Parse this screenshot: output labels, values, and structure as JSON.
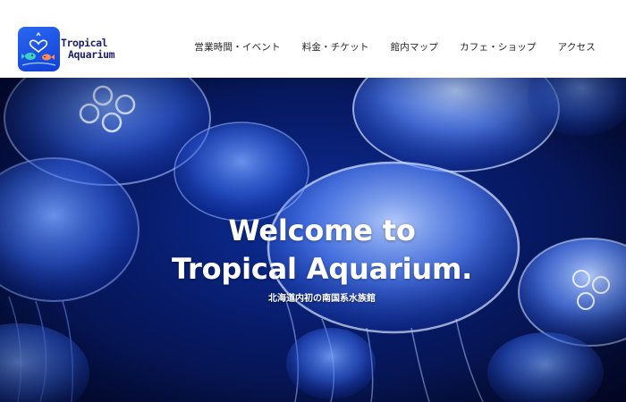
{
  "header": {
    "logo": {
      "line1": "Tropical",
      "line2": "Aquarium"
    },
    "nav": [
      {
        "label": "営業時間・イベント"
      },
      {
        "label": "料金・チケット"
      },
      {
        "label": "館内マップ"
      },
      {
        "label": "カフェ・ショップ"
      },
      {
        "label": "アクセス"
      }
    ]
  },
  "hero": {
    "title_line1": "Welcome to",
    "title_line2": "Tropical Aquarium.",
    "subtitle": "北海道内初の南国系水族館",
    "image": "jellyfish-photo"
  },
  "colors": {
    "brand_blue": "#1e50e6",
    "logo_text": "#1a1f6b",
    "hero_dark": "#030a2e",
    "hero_mid": "#0d2f9a",
    "jelly_glow": "#6f9bff"
  }
}
